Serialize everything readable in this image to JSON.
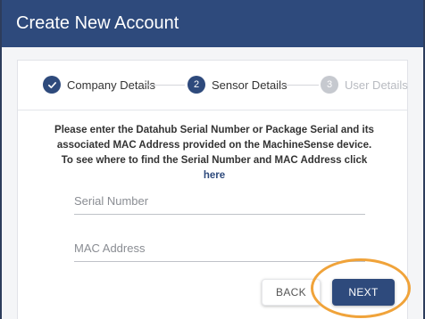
{
  "dialog": {
    "title": "Create New Account"
  },
  "stepper": {
    "steps": [
      {
        "number": "1",
        "label": "Company Details",
        "state": "completed",
        "icon": "check-icon"
      },
      {
        "number": "2",
        "label": "Sensor Details",
        "state": "active"
      },
      {
        "number": "3",
        "label": "User Details",
        "state": "pending"
      }
    ]
  },
  "instructions": {
    "text": "Please enter the Datahub Serial Number or Package Serial and its associated MAC Address provided on the MachineSense device. To see where to find the Serial Number and MAC Address click ",
    "link_text": "here"
  },
  "form": {
    "serial_placeholder": "Serial Number",
    "serial_value": "",
    "mac_placeholder": "MAC Address",
    "mac_value": ""
  },
  "buttons": {
    "back_label": "BACK",
    "next_label": "NEXT"
  },
  "colors": {
    "primary": "#2e4a7c",
    "highlight": "#f0a33a",
    "pending": "#c6c9cf"
  }
}
